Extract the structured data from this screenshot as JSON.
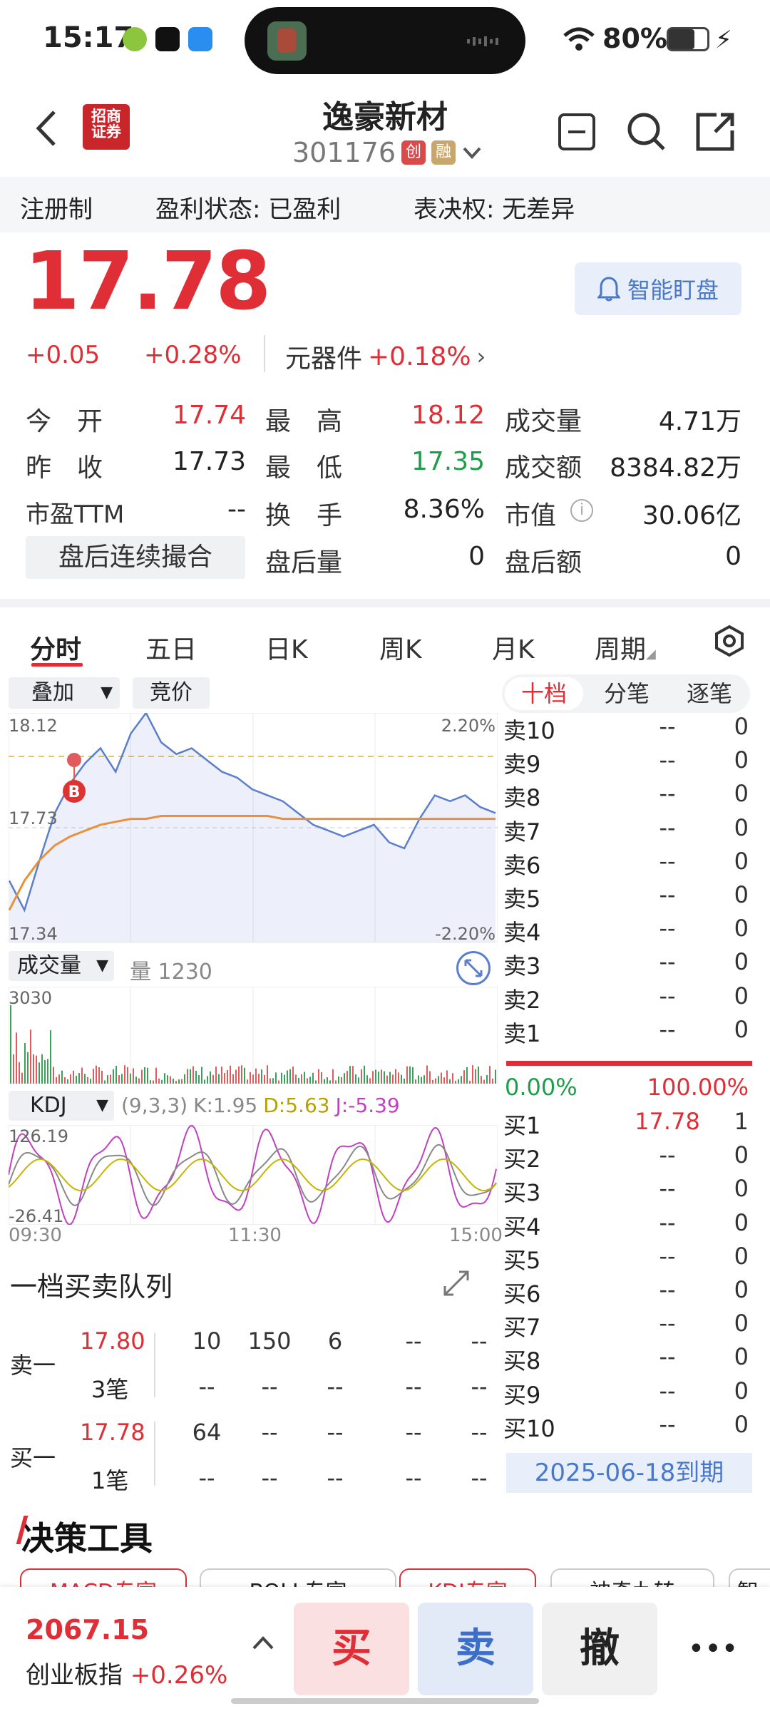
{
  "status_bar": {
    "time": "15:17",
    "battery": "80%"
  },
  "header": {
    "logo_text": "招商\n证券",
    "stock_name": "逸豪新材",
    "stock_code": "301176",
    "tag_chuang": "创",
    "tag_rong": "融"
  },
  "info_bar": {
    "reg": "注册制",
    "profit": "盈利状态: 已盈利",
    "vote": "表决权: 无差异"
  },
  "quote": {
    "price": "17.78",
    "change": "+0.05",
    "change_pct": "+0.28%",
    "sector": "元器件",
    "sector_pct": "+0.18%",
    "watch_btn": "智能盯盘"
  },
  "stats": {
    "open_l": "今　开",
    "open": "17.74",
    "high_l": "最　高",
    "high": "18.12",
    "vol_l": "成交量",
    "vol": "4.71万",
    "prev_l": "昨　收",
    "prev": "17.73",
    "low_l": "最　低",
    "low": "17.35",
    "amt_l": "成交额",
    "amt": "8384.82万",
    "pe_l": "市盈TTM",
    "pe": "--",
    "turn_l": "换　手",
    "turn": "8.36%",
    "mcap_l": "市值",
    "mcap": "30.06亿",
    "after_btn": "盘后连续撮合",
    "after_vol_l": "盘后量",
    "after_vol": "0",
    "after_amt_l": "盘后额",
    "after_amt": "0"
  },
  "tabs": [
    "分时",
    "五日",
    "日K",
    "周K",
    "月K",
    "周期"
  ],
  "chart_controls": {
    "overlay": "叠加",
    "auction": "竞价"
  },
  "chart_labels": {
    "price_top": "18.12",
    "price_mid": "17.73",
    "price_bot": "17.34",
    "pct_top": "2.20%",
    "pct_bot": "-2.20%",
    "vol_sel": "成交量",
    "vol_info": "量 1230",
    "vol_max": "3030",
    "kdj_sel": "KDJ",
    "kdj_params": "(9,3,3)",
    "kdj_k": "K:1.95",
    "kdj_d": "D:5.63",
    "kdj_j": "J:-5.39",
    "kdj_top": "126.19",
    "kdj_bot": "-26.41",
    "t_start": "09:30",
    "t_mid": "11:30",
    "t_end": "15:00",
    "buy_marker": "B"
  },
  "chart_data": {
    "type": "line",
    "title": "",
    "x_ticks": [
      "09:30",
      "11:30",
      "15:00"
    ],
    "ylim": [
      17.34,
      18.12
    ],
    "series": [
      {
        "values": [
          17.55,
          17.45,
          17.62,
          17.78,
          17.88,
          17.95,
          18.0,
          17.92,
          18.05,
          18.12,
          18.02,
          17.98,
          18.0,
          17.96,
          17.92,
          17.9,
          17.86,
          17.84,
          17.82,
          17.78,
          17.74,
          17.72,
          17.7,
          17.72,
          17.74,
          17.68,
          17.66,
          17.76,
          17.84,
          17.82,
          17.84,
          17.8,
          17.78
        ]
      },
      {
        "values": [
          17.45,
          17.55,
          17.62,
          17.67,
          17.7,
          17.72,
          17.74,
          17.75,
          17.76,
          17.76,
          17.77,
          17.77,
          17.77,
          17.77,
          17.77,
          17.77,
          17.77,
          17.77,
          17.76,
          17.76,
          17.76,
          17.76,
          17.76,
          17.76,
          17.76,
          17.76,
          17.76,
          17.76,
          17.76,
          17.76,
          17.76,
          17.76,
          17.76
        ]
      }
    ]
  },
  "orderbook": {
    "tabs": [
      "十档",
      "分笔",
      "逐笔"
    ],
    "sells": [
      {
        "n": "卖10",
        "p": "--",
        "q": "0"
      },
      {
        "n": "卖9",
        "p": "--",
        "q": "0"
      },
      {
        "n": "卖8",
        "p": "--",
        "q": "0"
      },
      {
        "n": "卖7",
        "p": "--",
        "q": "0"
      },
      {
        "n": "卖6",
        "p": "--",
        "q": "0"
      },
      {
        "n": "卖5",
        "p": "--",
        "q": "0"
      },
      {
        "n": "卖4",
        "p": "--",
        "q": "0"
      },
      {
        "n": "卖3",
        "p": "--",
        "q": "0"
      },
      {
        "n": "卖2",
        "p": "--",
        "q": "0"
      },
      {
        "n": "卖1",
        "p": "--",
        "q": "0"
      }
    ],
    "ratio_buy": "0.00%",
    "ratio_sell": "100.00%",
    "buys": [
      {
        "n": "买1",
        "p": "17.78",
        "q": "1"
      },
      {
        "n": "买2",
        "p": "--",
        "q": "0"
      },
      {
        "n": "买3",
        "p": "--",
        "q": "0"
      },
      {
        "n": "买4",
        "p": "--",
        "q": "0"
      },
      {
        "n": "买5",
        "p": "--",
        "q": "0"
      },
      {
        "n": "买6",
        "p": "--",
        "q": "0"
      },
      {
        "n": "买7",
        "p": "--",
        "q": "0"
      },
      {
        "n": "买8",
        "p": "--",
        "q": "0"
      },
      {
        "n": "买9",
        "p": "--",
        "q": "0"
      },
      {
        "n": "买10",
        "p": "--",
        "q": "0"
      }
    ],
    "expiry": "2025-06-18到期"
  },
  "queue": {
    "title": "一档买卖队列",
    "sell_label": "卖一",
    "sell_price": "17.80",
    "sell_count": "3笔",
    "sell_row1": [
      "10",
      "150",
      "6",
      "--",
      "--"
    ],
    "sell_row2": [
      "--",
      "--",
      "--",
      "--",
      "--"
    ],
    "buy_label": "买一",
    "buy_price": "17.78",
    "buy_count": "1笔",
    "buy_row1": [
      "64",
      "--",
      "--",
      "--",
      "--"
    ],
    "buy_row2": [
      "--",
      "--",
      "--",
      "--",
      "--"
    ]
  },
  "tools": {
    "title": "决策工具",
    "chips": [
      "MACD专家",
      "BOLL专家",
      "KDJ专家",
      "神奇九转",
      "智"
    ]
  },
  "bottom": {
    "index_value": "2067.15",
    "index_name": "创业板指",
    "index_pct": "+0.26%",
    "buy": "买",
    "sell": "卖",
    "cancel": "撤",
    "more": "•••"
  }
}
